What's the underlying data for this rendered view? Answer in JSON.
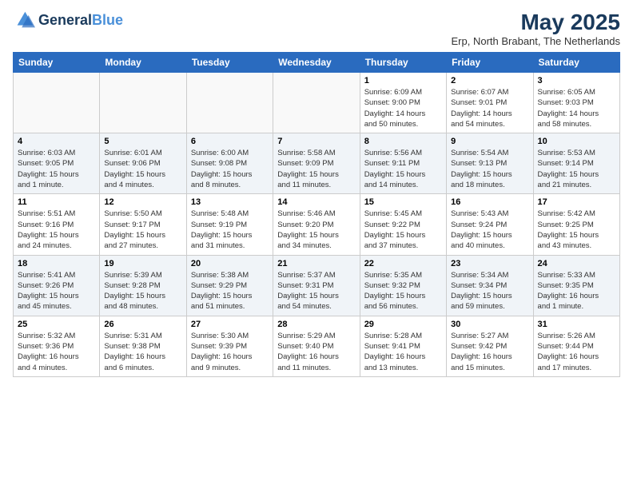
{
  "logo": {
    "line1": "General",
    "line2": "Blue"
  },
  "title": "May 2025",
  "subtitle": "Erp, North Brabant, The Netherlands",
  "weekdays": [
    "Sunday",
    "Monday",
    "Tuesday",
    "Wednesday",
    "Thursday",
    "Friday",
    "Saturday"
  ],
  "weeks": [
    [
      {
        "day": "",
        "info": ""
      },
      {
        "day": "",
        "info": ""
      },
      {
        "day": "",
        "info": ""
      },
      {
        "day": "",
        "info": ""
      },
      {
        "day": "1",
        "info": "Sunrise: 6:09 AM\nSunset: 9:00 PM\nDaylight: 14 hours\nand 50 minutes."
      },
      {
        "day": "2",
        "info": "Sunrise: 6:07 AM\nSunset: 9:01 PM\nDaylight: 14 hours\nand 54 minutes."
      },
      {
        "day": "3",
        "info": "Sunrise: 6:05 AM\nSunset: 9:03 PM\nDaylight: 14 hours\nand 58 minutes."
      }
    ],
    [
      {
        "day": "4",
        "info": "Sunrise: 6:03 AM\nSunset: 9:05 PM\nDaylight: 15 hours\nand 1 minute."
      },
      {
        "day": "5",
        "info": "Sunrise: 6:01 AM\nSunset: 9:06 PM\nDaylight: 15 hours\nand 4 minutes."
      },
      {
        "day": "6",
        "info": "Sunrise: 6:00 AM\nSunset: 9:08 PM\nDaylight: 15 hours\nand 8 minutes."
      },
      {
        "day": "7",
        "info": "Sunrise: 5:58 AM\nSunset: 9:09 PM\nDaylight: 15 hours\nand 11 minutes."
      },
      {
        "day": "8",
        "info": "Sunrise: 5:56 AM\nSunset: 9:11 PM\nDaylight: 15 hours\nand 14 minutes."
      },
      {
        "day": "9",
        "info": "Sunrise: 5:54 AM\nSunset: 9:13 PM\nDaylight: 15 hours\nand 18 minutes."
      },
      {
        "day": "10",
        "info": "Sunrise: 5:53 AM\nSunset: 9:14 PM\nDaylight: 15 hours\nand 21 minutes."
      }
    ],
    [
      {
        "day": "11",
        "info": "Sunrise: 5:51 AM\nSunset: 9:16 PM\nDaylight: 15 hours\nand 24 minutes."
      },
      {
        "day": "12",
        "info": "Sunrise: 5:50 AM\nSunset: 9:17 PM\nDaylight: 15 hours\nand 27 minutes."
      },
      {
        "day": "13",
        "info": "Sunrise: 5:48 AM\nSunset: 9:19 PM\nDaylight: 15 hours\nand 31 minutes."
      },
      {
        "day": "14",
        "info": "Sunrise: 5:46 AM\nSunset: 9:20 PM\nDaylight: 15 hours\nand 34 minutes."
      },
      {
        "day": "15",
        "info": "Sunrise: 5:45 AM\nSunset: 9:22 PM\nDaylight: 15 hours\nand 37 minutes."
      },
      {
        "day": "16",
        "info": "Sunrise: 5:43 AM\nSunset: 9:24 PM\nDaylight: 15 hours\nand 40 minutes."
      },
      {
        "day": "17",
        "info": "Sunrise: 5:42 AM\nSunset: 9:25 PM\nDaylight: 15 hours\nand 43 minutes."
      }
    ],
    [
      {
        "day": "18",
        "info": "Sunrise: 5:41 AM\nSunset: 9:26 PM\nDaylight: 15 hours\nand 45 minutes."
      },
      {
        "day": "19",
        "info": "Sunrise: 5:39 AM\nSunset: 9:28 PM\nDaylight: 15 hours\nand 48 minutes."
      },
      {
        "day": "20",
        "info": "Sunrise: 5:38 AM\nSunset: 9:29 PM\nDaylight: 15 hours\nand 51 minutes."
      },
      {
        "day": "21",
        "info": "Sunrise: 5:37 AM\nSunset: 9:31 PM\nDaylight: 15 hours\nand 54 minutes."
      },
      {
        "day": "22",
        "info": "Sunrise: 5:35 AM\nSunset: 9:32 PM\nDaylight: 15 hours\nand 56 minutes."
      },
      {
        "day": "23",
        "info": "Sunrise: 5:34 AM\nSunset: 9:34 PM\nDaylight: 15 hours\nand 59 minutes."
      },
      {
        "day": "24",
        "info": "Sunrise: 5:33 AM\nSunset: 9:35 PM\nDaylight: 16 hours\nand 1 minute."
      }
    ],
    [
      {
        "day": "25",
        "info": "Sunrise: 5:32 AM\nSunset: 9:36 PM\nDaylight: 16 hours\nand 4 minutes."
      },
      {
        "day": "26",
        "info": "Sunrise: 5:31 AM\nSunset: 9:38 PM\nDaylight: 16 hours\nand 6 minutes."
      },
      {
        "day": "27",
        "info": "Sunrise: 5:30 AM\nSunset: 9:39 PM\nDaylight: 16 hours\nand 9 minutes."
      },
      {
        "day": "28",
        "info": "Sunrise: 5:29 AM\nSunset: 9:40 PM\nDaylight: 16 hours\nand 11 minutes."
      },
      {
        "day": "29",
        "info": "Sunrise: 5:28 AM\nSunset: 9:41 PM\nDaylight: 16 hours\nand 13 minutes."
      },
      {
        "day": "30",
        "info": "Sunrise: 5:27 AM\nSunset: 9:42 PM\nDaylight: 16 hours\nand 15 minutes."
      },
      {
        "day": "31",
        "info": "Sunrise: 5:26 AM\nSunset: 9:44 PM\nDaylight: 16 hours\nand 17 minutes."
      }
    ]
  ]
}
